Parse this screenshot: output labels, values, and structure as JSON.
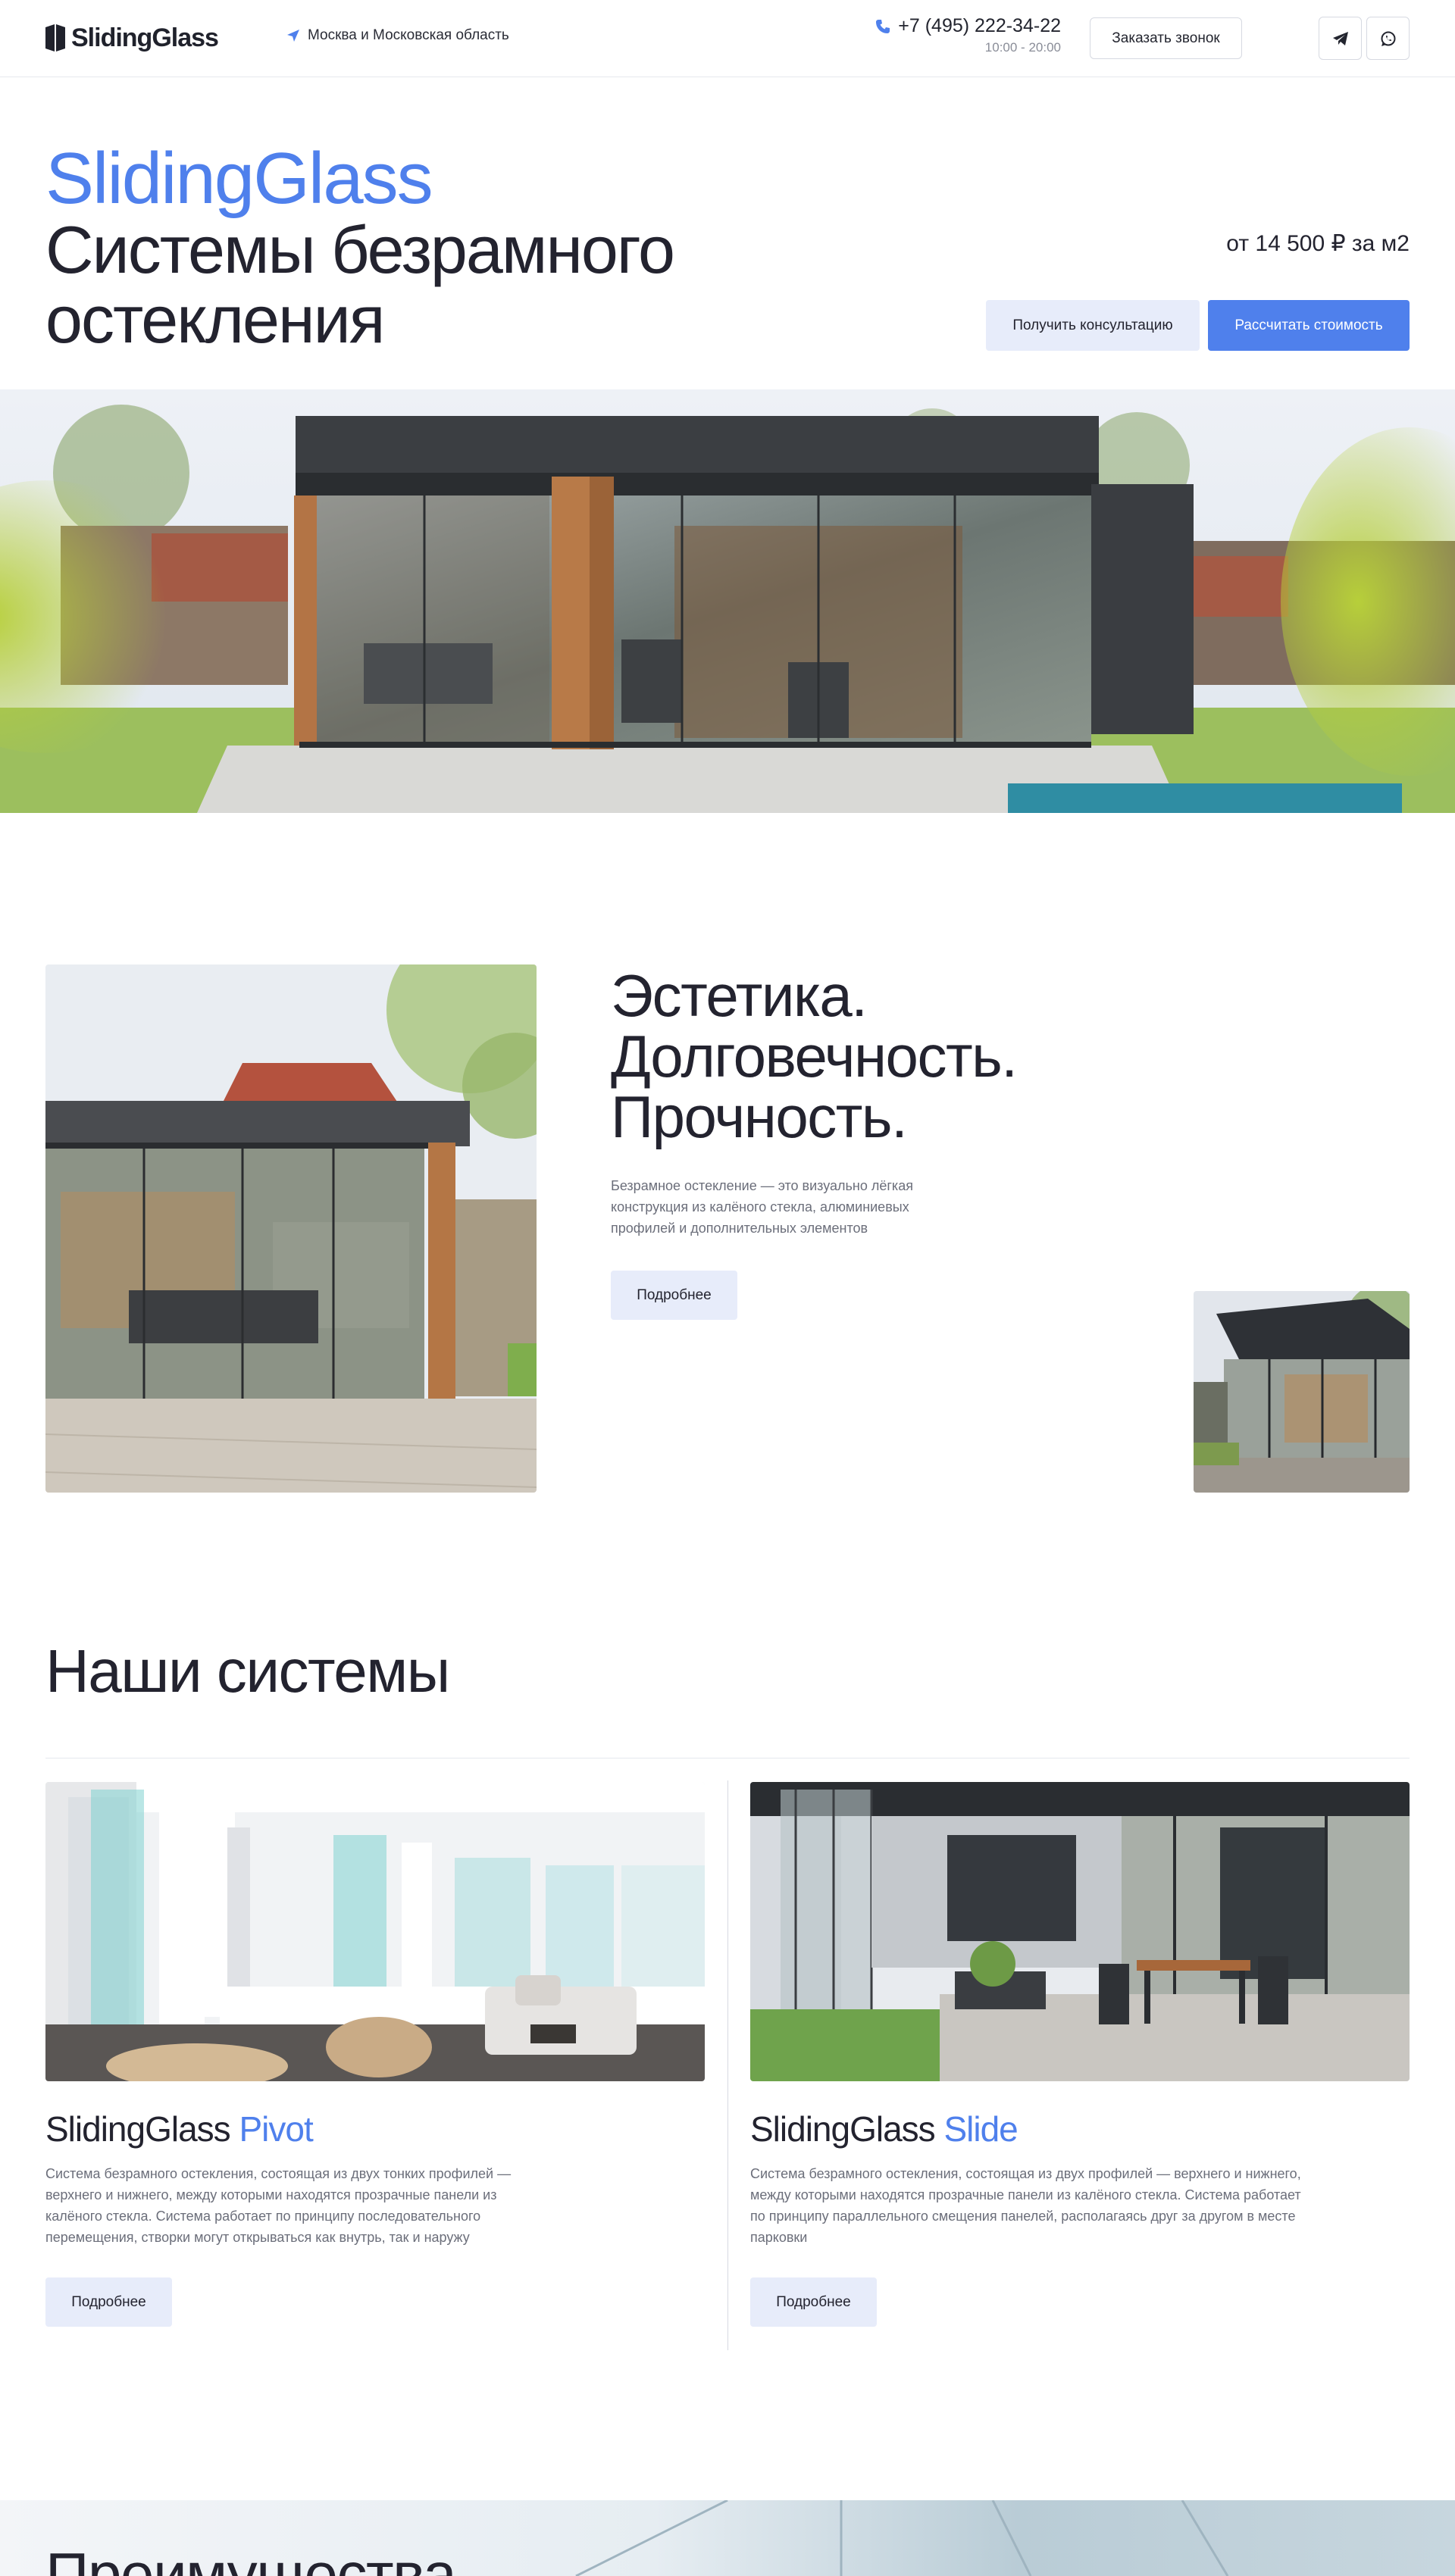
{
  "header": {
    "logo_text": "SlidingGlass",
    "region": "Москва и Московская область",
    "phone": "+7 (495) 222-34-22",
    "hours": "10:00 - 20:00",
    "callback_label": "Заказать звонок",
    "icons": [
      "location-arrow-icon",
      "phone-icon",
      "telegram-icon",
      "whatsapp-icon"
    ]
  },
  "hero": {
    "brand": "SlidingGlass",
    "title": "Системы безрамного остекления",
    "price": "от 14 500 ₽ за м2",
    "consult_label": "Получить консультацию",
    "calc_label": "Рассчитать стоимость"
  },
  "aesthetic": {
    "title_line1": "Эстетика.",
    "title_line2": "Долговечность.",
    "title_line3": "Прочность.",
    "text": "Безрамное остекление — это визуально лёгкая конструкция из калёного стекла, алюминиевых профилей и дополнительных элементов",
    "more_label": "Подробнее"
  },
  "systems": {
    "title": "Наши системы",
    "cards": [
      {
        "brand": "SlidingGlass",
        "accent": "Pivot",
        "text": "Система безрамного остекления, состоящая из двух тонких профилей — верхнего и нижнего, между которыми находятся прозрачные панели из калёного стекла. Система работает по принципу последовательного перемещения, створки могут открываться как внутрь, так и наружу",
        "more_label": "Подробнее"
      },
      {
        "brand": "SlidingGlass",
        "accent": "Slide",
        "text": "Система безрамного остекления, состоящая из двух профилей — верхнего и нижнего, между которыми находятся прозрачные панели из калёного стекла. Система работает по принципу параллельного смещения панелей, располагаясь друг за другом в месте парковки",
        "more_label": "Подробнее"
      }
    ]
  },
  "advantages": {
    "title": "Преимущества"
  },
  "colors": {
    "accent": "#4f80ec",
    "text": "#23232f",
    "muted": "#6b6e7a",
    "button_light": "#e7ecfa"
  }
}
